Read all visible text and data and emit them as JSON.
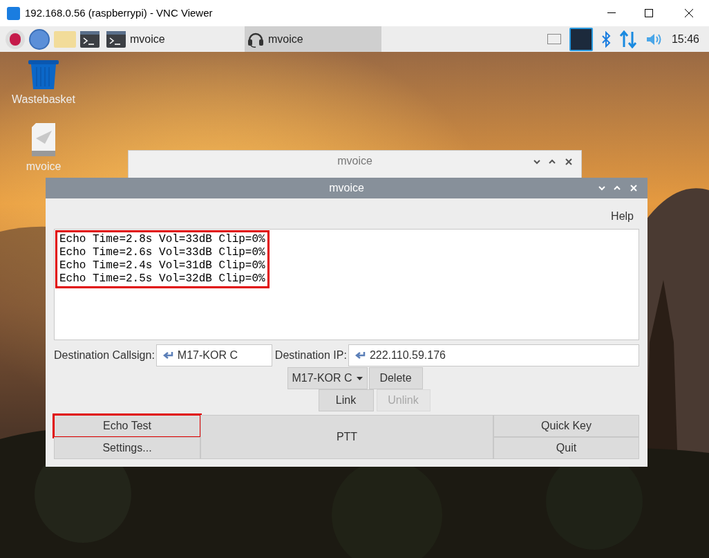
{
  "viewer_window": {
    "title": "192.168.0.56 (raspberrypi) - VNC Viewer"
  },
  "taskbar": {
    "tasks": [
      {
        "label": "mvoice",
        "kind": "terminal",
        "selected": false
      },
      {
        "label": "mvoice",
        "kind": "headset",
        "selected": true
      }
    ],
    "clock": "15:46"
  },
  "desktop_icons": [
    {
      "label": "Wastebasket",
      "kind": "trash"
    },
    {
      "label": "mvoice",
      "kind": "file"
    }
  ],
  "background_window": {
    "title": "mvoice"
  },
  "main_window": {
    "title": "mvoice",
    "menu": [
      "Help"
    ],
    "log": {
      "highlighted": true,
      "lines": [
        "Echo Time=2.8s Vol=33dB Clip=0%",
        "Echo Time=2.6s Vol=33dB Clip=0%",
        "Echo Time=2.4s Vol=31dB Clip=0%",
        "Echo Time=2.5s Vol=32dB Clip=0%"
      ]
    },
    "callsign": {
      "label": "Destination Callsign:",
      "value": "M17-KOR C"
    },
    "ip": {
      "label": "Destination IP:",
      "value": "222.110.59.176"
    },
    "reflector_select": {
      "value": "M17-KOR C"
    },
    "buttons": [
      {
        "label": "Delete",
        "disabled": false,
        "highlighted": false
      },
      {
        "label": "Link",
        "disabled": false,
        "highlighted": false
      },
      {
        "label": "Unlink",
        "disabled": true,
        "highlighted": false
      },
      {
        "label": "Echo Test",
        "disabled": false,
        "highlighted": true
      },
      {
        "label": "Settings...",
        "disabled": false,
        "highlighted": false
      },
      {
        "label": "PTT",
        "disabled": false,
        "highlighted": false
      },
      {
        "label": "Quick Key",
        "disabled": false,
        "highlighted": false
      },
      {
        "label": "Quit",
        "disabled": false,
        "highlighted": false
      }
    ]
  }
}
